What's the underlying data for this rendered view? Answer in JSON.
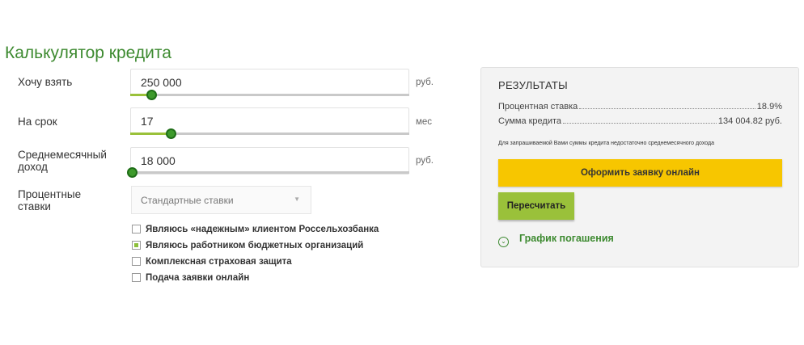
{
  "title": "Калькулятор кредита",
  "form": {
    "amount": {
      "label": "Хочу взять",
      "value": "250 000",
      "unit": "руб.",
      "slider_fraction": 0.07
    },
    "term": {
      "label": "На срок",
      "value": "17",
      "unit": "мес",
      "slider_fraction": 0.14
    },
    "income": {
      "label_line1": "Среднемесячный",
      "label_line2": "доход",
      "value": "18 000",
      "unit": "руб.",
      "slider_fraction": 0.0
    },
    "rates": {
      "label_line1": "Процентные",
      "label_line2": "ставки",
      "selected": "Стандартные ставки",
      "arrow": "▼"
    },
    "checkboxes": [
      {
        "label": "Являюсь «надежным» клиентом Россельхозбанка",
        "checked": false
      },
      {
        "label": "Являюсь работником бюджетных организаций",
        "checked": true
      },
      {
        "label": "Комплексная страховая защита",
        "checked": false
      },
      {
        "label": "Подача заявки онлайн",
        "checked": false
      }
    ]
  },
  "results": {
    "title": "РЕЗУЛЬТАТЫ",
    "rate_label": "Процентная ставка",
    "rate_value": "18.9%",
    "sum_label": "Сумма кредита",
    "sum_value": "134 004.82 руб.",
    "note": "Для запрашиваемой Вами суммы кредита недостаточно среднемесячного дохода",
    "apply_button": "Оформить заявку онлайн",
    "recalc_button": "Пересчитать",
    "schedule_link": "График погашения",
    "schedule_icon": "chevron-down-circle-icon"
  },
  "colors": {
    "accent_green": "#3d8a30",
    "slider_fill": "#9ac13a",
    "button_yellow": "#f7c600"
  }
}
